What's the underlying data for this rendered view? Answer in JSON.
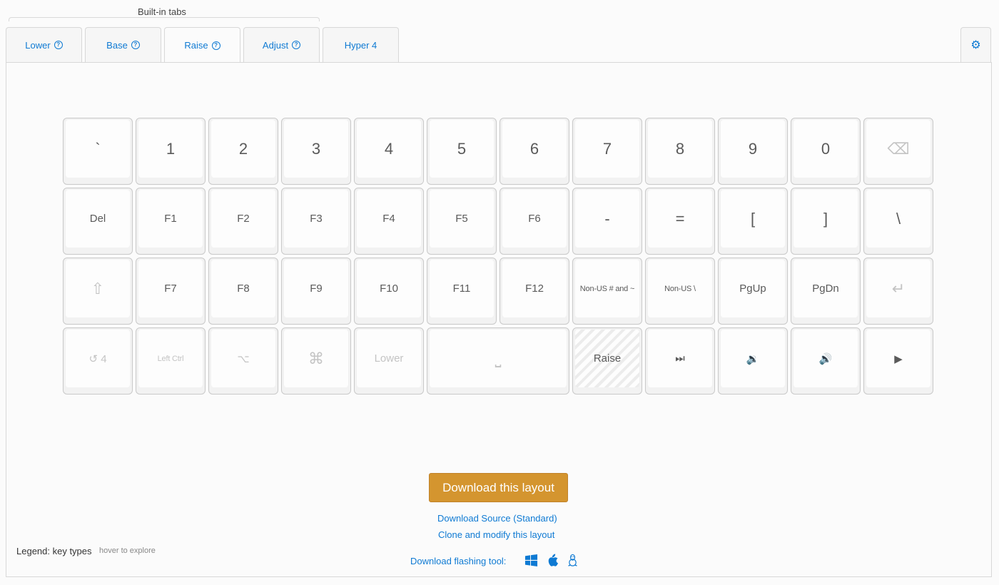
{
  "header": {
    "builtin_tabs_label": "Built-in tabs"
  },
  "tabs": [
    {
      "label": "Lower",
      "has_help": true,
      "active": false
    },
    {
      "label": "Base",
      "has_help": true,
      "active": false
    },
    {
      "label": "Raise",
      "has_help": true,
      "active": true
    },
    {
      "label": "Adjust",
      "has_help": true,
      "active": false
    },
    {
      "label": "Hyper 4",
      "has_help": false,
      "active": false
    }
  ],
  "settings_icon": "gear-icon",
  "keyboard": {
    "rows": [
      [
        {
          "label": "`",
          "size": "big"
        },
        {
          "label": "1",
          "size": "big"
        },
        {
          "label": "2",
          "size": "big"
        },
        {
          "label": "3",
          "size": "big"
        },
        {
          "label": "4",
          "size": "big"
        },
        {
          "label": "5",
          "size": "big"
        },
        {
          "label": "6",
          "size": "big"
        },
        {
          "label": "7",
          "size": "big"
        },
        {
          "label": "8",
          "size": "big"
        },
        {
          "label": "9",
          "size": "big"
        },
        {
          "label": "0",
          "size": "big"
        },
        {
          "label": "⌫",
          "size": "big",
          "faded": true,
          "icon": "backspace-icon"
        }
      ],
      [
        {
          "label": "Del",
          "size": "mid"
        },
        {
          "label": "F1",
          "size": "mid"
        },
        {
          "label": "F2",
          "size": "mid"
        },
        {
          "label": "F3",
          "size": "mid"
        },
        {
          "label": "F4",
          "size": "mid"
        },
        {
          "label": "F5",
          "size": "mid"
        },
        {
          "label": "F6",
          "size": "mid"
        },
        {
          "label": "-",
          "size": "big"
        },
        {
          "label": "=",
          "size": "big"
        },
        {
          "label": "[",
          "size": "big"
        },
        {
          "label": "]",
          "size": "big"
        },
        {
          "label": "\\",
          "size": "big"
        }
      ],
      [
        {
          "label": "⇧",
          "size": "big",
          "faded": true,
          "icon": "shift-icon"
        },
        {
          "label": "F7",
          "size": "mid"
        },
        {
          "label": "F8",
          "size": "mid"
        },
        {
          "label": "F9",
          "size": "mid"
        },
        {
          "label": "F10",
          "size": "mid"
        },
        {
          "label": "F11",
          "size": "mid"
        },
        {
          "label": "F12",
          "size": "mid"
        },
        {
          "label": "Non-US # and ~",
          "size": "small"
        },
        {
          "label": "Non-US \\",
          "size": "small"
        },
        {
          "label": "PgUp",
          "size": "mid"
        },
        {
          "label": "PgDn",
          "size": "mid"
        },
        {
          "label": "↵",
          "size": "big",
          "faded": true,
          "icon": "enter-icon"
        }
      ],
      [
        {
          "label": "↺ 4",
          "size": "mid",
          "faded": true
        },
        {
          "label": "Left Ctrl",
          "size": "small",
          "faded": true
        },
        {
          "label": "⌥",
          "size": "mid",
          "faded": true,
          "icon": "option-icon"
        },
        {
          "label": "⌘",
          "size": "big",
          "faded": true,
          "icon": "command-icon"
        },
        {
          "label": "Lower",
          "size": "mid",
          "faded": true
        },
        {
          "label": "⎵",
          "size": "big",
          "faded": true,
          "wide": true,
          "icon": "space-icon"
        },
        {
          "label": "Raise",
          "size": "mid",
          "active": true
        },
        {
          "label": "⏭",
          "size": "mid",
          "icon": "next-track-icon"
        },
        {
          "label": "🔉",
          "size": "mid",
          "icon": "volume-down-icon"
        },
        {
          "label": "🔊",
          "size": "mid",
          "icon": "volume-up-icon"
        },
        {
          "label": "▶",
          "size": "mid",
          "icon": "play-icon"
        }
      ]
    ]
  },
  "actions": {
    "download_layout": "Download this layout",
    "download_source": "Download Source (Standard)",
    "clone_modify": "Clone and modify this layout",
    "flash_tool_label": "Download flashing tool:",
    "os_icons": [
      "windows-icon",
      "apple-icon",
      "linux-icon"
    ]
  },
  "legend": {
    "label": "Legend: key types",
    "hint": "hover to explore"
  },
  "colors": {
    "link": "#0e7ad3",
    "download_button": "#d4952f"
  }
}
